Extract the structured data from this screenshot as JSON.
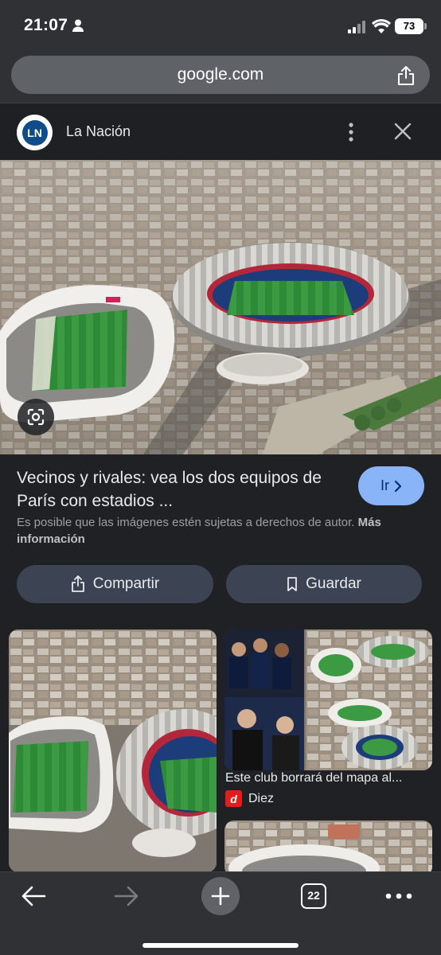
{
  "status_bar": {
    "time": "21:07",
    "battery": "73"
  },
  "address_bar": {
    "url": "google.com"
  },
  "source": {
    "logo_text": "LN",
    "name": "La Nación"
  },
  "result": {
    "title": "Vecinos y rivales: vea los dos equipos de París con estadios ...",
    "go_label": "Ir",
    "copyright_text": "Es posible que las imágenes estén sujetas a derechos de autor.",
    "more_info": "Más información"
  },
  "actions": {
    "share_label": "Compartir",
    "save_label": "Guardar"
  },
  "related": [
    {
      "caption": "",
      "source": ""
    },
    {
      "caption": "Este club borrará del mapa al...",
      "source": "Diez",
      "source_logo": "d"
    }
  ],
  "toolbar": {
    "tab_count": "22"
  },
  "colors": {
    "accent": "#8ab4f8",
    "chip_bg": "#3c4454",
    "diez_red": "#e11d1d"
  }
}
